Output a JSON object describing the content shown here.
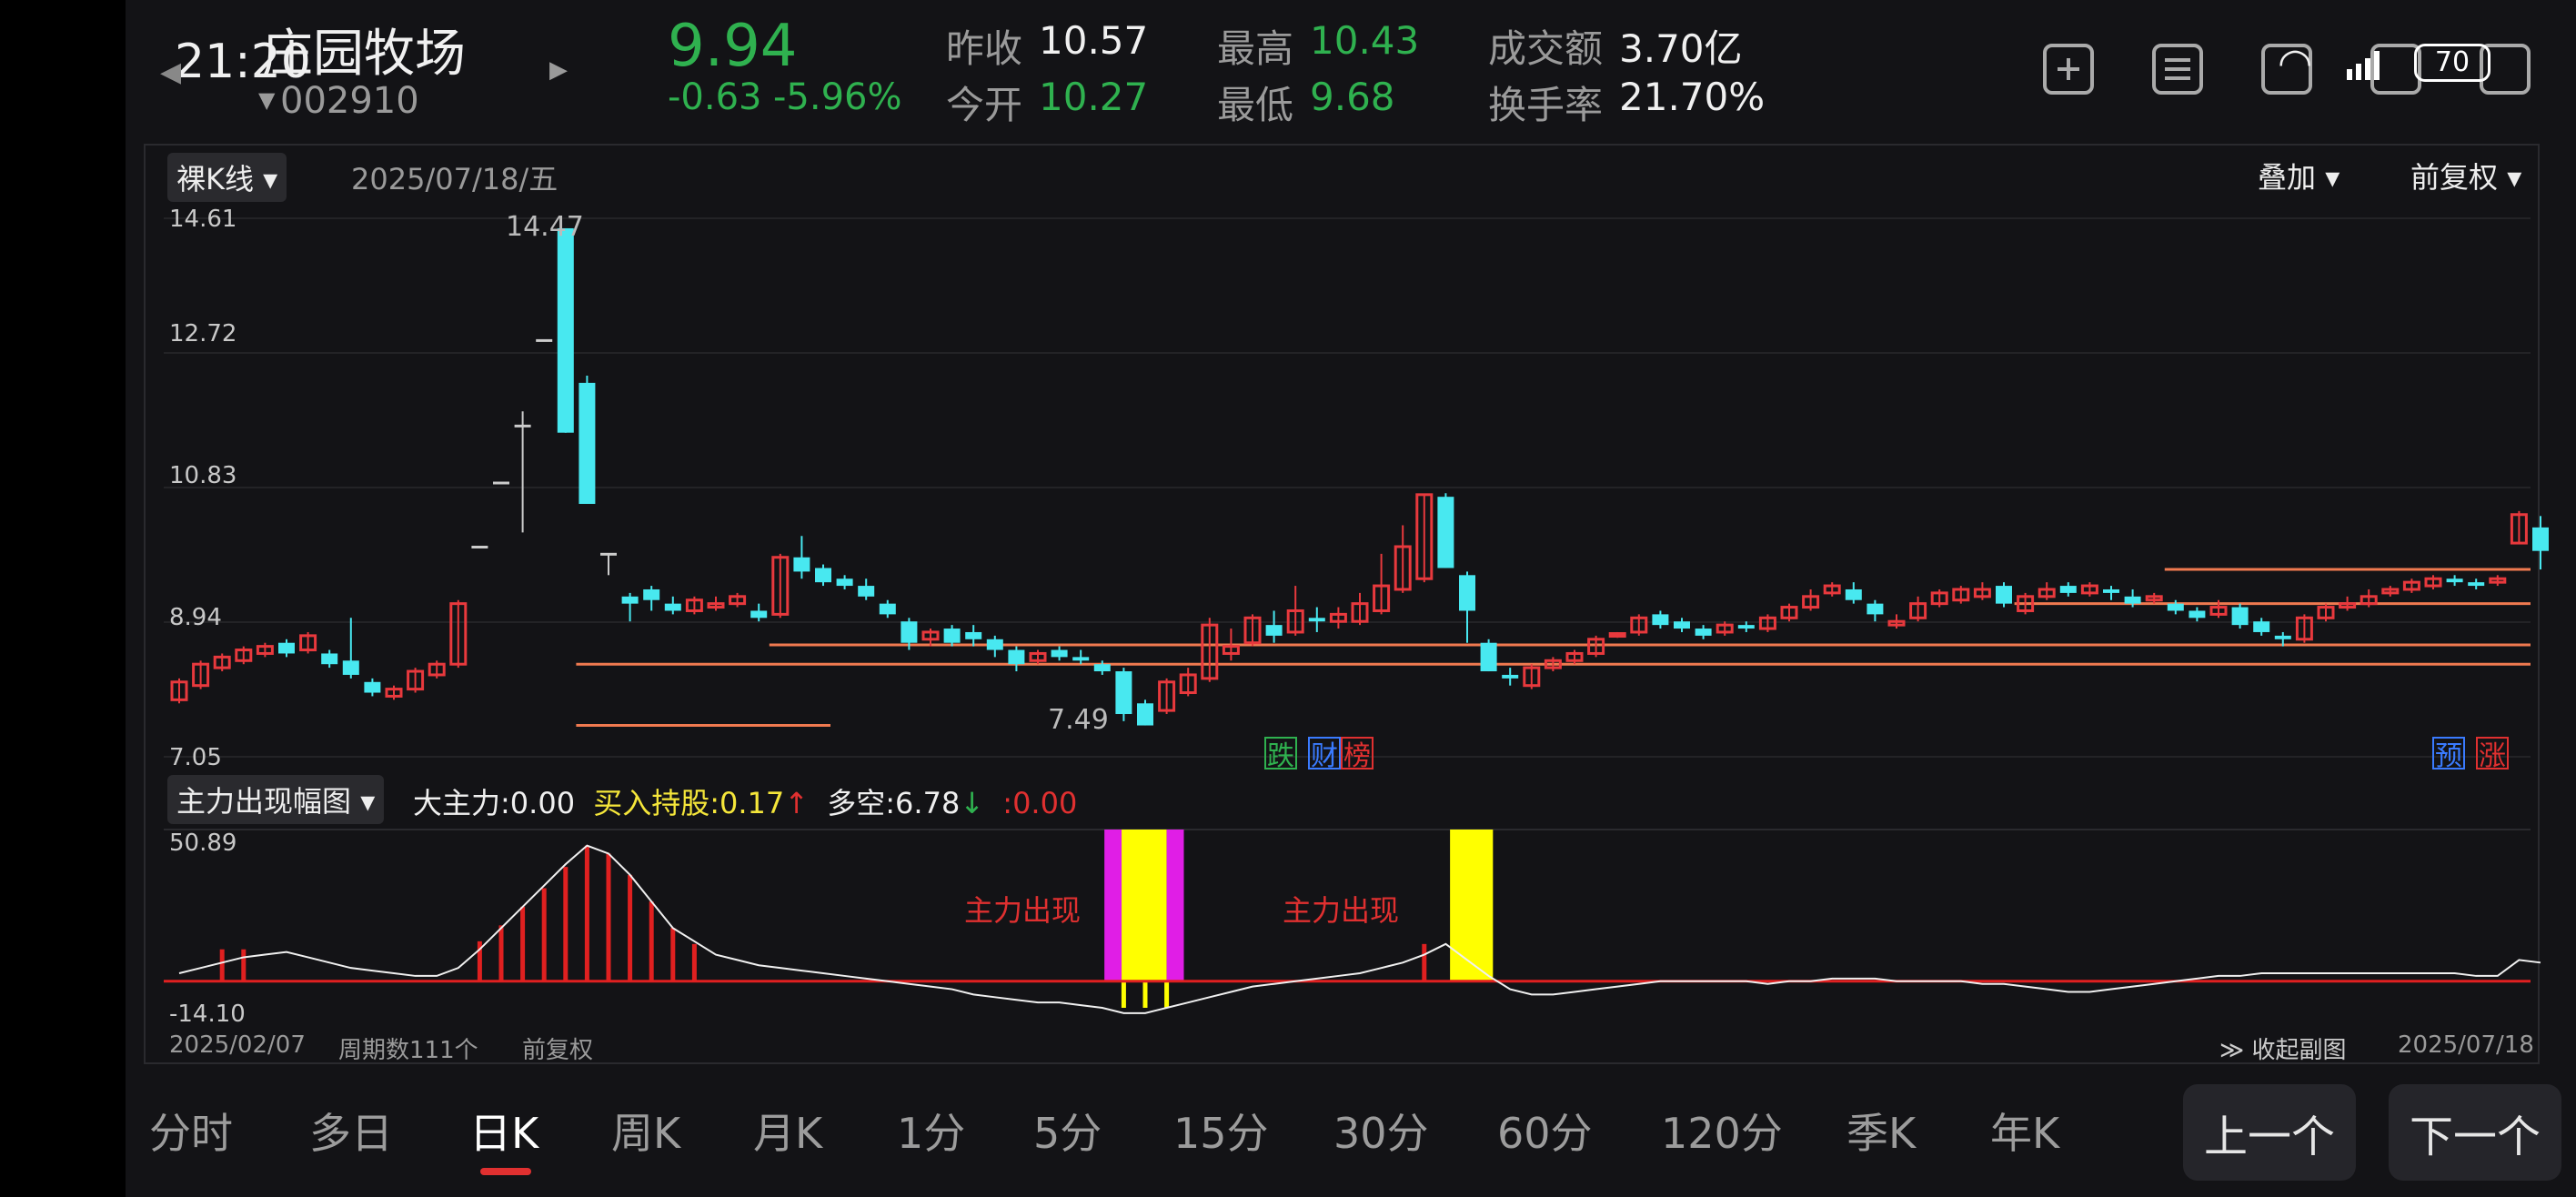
{
  "status": {
    "time": "21:20",
    "battery": "70"
  },
  "header": {
    "name": "庄园牧场",
    "code": "002910",
    "price": "9.94",
    "change": "-0.63",
    "change_pct": "-5.96%",
    "stats": [
      {
        "label": "昨收",
        "value": "10.57",
        "color": "#f0f0f0"
      },
      {
        "label": "今开",
        "value": "10.27",
        "color": "#2fb14f"
      },
      {
        "label": "最高",
        "value": "10.43",
        "color": "#2fb14f"
      },
      {
        "label": "最低",
        "value": "9.68",
        "color": "#2fb14f"
      },
      {
        "label": "成交额",
        "value": "3.70亿",
        "color": "#f0f0f0"
      },
      {
        "label": "换手率",
        "value": "21.70%",
        "color": "#f0f0f0"
      }
    ]
  },
  "chart_toolbar": {
    "mode": "裸K线",
    "date": "2025/07/18/五",
    "overlay": "叠加",
    "adjust": "前复权"
  },
  "chart_data": [
    {
      "type": "candlestick",
      "title": "日K",
      "ylim": [
        7.05,
        14.61
      ],
      "y_ticks": [
        "14.61",
        "12.72",
        "10.83",
        "8.94",
        "7.05"
      ],
      "annotations": {
        "high": "14.47",
        "low": "7.49"
      },
      "tags": [
        "跌",
        "财",
        "榜",
        "预",
        "涨"
      ],
      "candles": [
        [
          7.85,
          8.1,
          7.8,
          8.15
        ],
        [
          8.05,
          8.35,
          8.0,
          8.4
        ],
        [
          8.3,
          8.45,
          8.25,
          8.5
        ],
        [
          8.4,
          8.55,
          8.35,
          8.6
        ],
        [
          8.5,
          8.6,
          8.45,
          8.65
        ],
        [
          8.65,
          8.5,
          8.45,
          8.7
        ],
        [
          8.55,
          8.75,
          8.5,
          8.8
        ],
        [
          8.5,
          8.35,
          8.3,
          8.55
        ],
        [
          8.4,
          8.2,
          8.15,
          9.0
        ],
        [
          8.1,
          7.95,
          7.9,
          8.15
        ],
        [
          7.9,
          8.0,
          7.85,
          8.05
        ],
        [
          8.0,
          8.25,
          7.95,
          8.3
        ],
        [
          8.2,
          8.35,
          8.15,
          8.4
        ],
        [
          8.35,
          9.2,
          8.3,
          9.25
        ],
        [
          10.0,
          10.0,
          10.0,
          10.0
        ],
        [
          10.9,
          10.9,
          10.9,
          10.9
        ],
        [
          11.7,
          11.7,
          10.2,
          11.9
        ],
        [
          12.9,
          12.9,
          12.9,
          12.9
        ],
        [
          14.47,
          11.6,
          11.6,
          14.47
        ],
        [
          12.3,
          10.6,
          10.6,
          12.4
        ],
        [
          9.9,
          9.9,
          9.6,
          9.9
        ],
        [
          9.3,
          9.2,
          8.95,
          9.35
        ],
        [
          9.4,
          9.25,
          9.1,
          9.45
        ],
        [
          9.2,
          9.1,
          9.05,
          9.3
        ],
        [
          9.1,
          9.25,
          9.05,
          9.3
        ],
        [
          9.15,
          9.2,
          9.1,
          9.3
        ],
        [
          9.2,
          9.3,
          9.15,
          9.35
        ],
        [
          9.1,
          9.0,
          8.95,
          9.2
        ],
        [
          9.05,
          9.85,
          9.0,
          9.9
        ],
        [
          9.85,
          9.65,
          9.55,
          10.15
        ],
        [
          9.7,
          9.5,
          9.45,
          9.75
        ],
        [
          9.55,
          9.45,
          9.4,
          9.6
        ],
        [
          9.45,
          9.3,
          9.25,
          9.55
        ],
        [
          9.2,
          9.05,
          9.0,
          9.25
        ],
        [
          8.95,
          8.65,
          8.55,
          9.0
        ],
        [
          8.7,
          8.8,
          8.6,
          8.85
        ],
        [
          8.85,
          8.65,
          8.6,
          8.9
        ],
        [
          8.8,
          8.7,
          8.6,
          8.9
        ],
        [
          8.7,
          8.55,
          8.45,
          8.75
        ],
        [
          8.55,
          8.35,
          8.25,
          8.6
        ],
        [
          8.4,
          8.5,
          8.35,
          8.55
        ],
        [
          8.55,
          8.45,
          8.4,
          8.6
        ],
        [
          8.45,
          8.4,
          8.35,
          8.55
        ],
        [
          8.35,
          8.25,
          8.2,
          8.4
        ],
        [
          8.25,
          7.65,
          7.55,
          8.3
        ],
        [
          7.8,
          7.49,
          7.49,
          7.85
        ],
        [
          7.7,
          8.1,
          7.65,
          8.15
        ],
        [
          7.95,
          8.2,
          7.9,
          8.3
        ],
        [
          8.15,
          8.9,
          8.1,
          9.0
        ],
        [
          8.5,
          8.6,
          8.4,
          8.85
        ],
        [
          8.65,
          9.0,
          8.6,
          9.05
        ],
        [
          8.9,
          8.75,
          8.65,
          9.1
        ],
        [
          8.8,
          9.1,
          8.75,
          9.45
        ],
        [
          9.0,
          8.95,
          8.8,
          9.15
        ],
        [
          8.95,
          9.05,
          8.85,
          9.15
        ],
        [
          8.95,
          9.2,
          8.9,
          9.35
        ],
        [
          9.1,
          9.45,
          9.05,
          9.9
        ],
        [
          9.4,
          10.0,
          9.35,
          10.3
        ],
        [
          9.55,
          10.73,
          9.5,
          10.73
        ],
        [
          10.7,
          9.7,
          9.7,
          10.75
        ],
        [
          9.6,
          9.1,
          8.65,
          9.65
        ],
        [
          8.65,
          8.25,
          8.25,
          8.7
        ],
        [
          8.2,
          8.15,
          8.05,
          8.3
        ],
        [
          8.05,
          8.3,
          8.0,
          8.35
        ],
        [
          8.3,
          8.4,
          8.25,
          8.45
        ],
        [
          8.4,
          8.5,
          8.35,
          8.55
        ],
        [
          8.5,
          8.7,
          8.45,
          8.75
        ],
        [
          8.75,
          8.78,
          8.72,
          8.8
        ],
        [
          8.8,
          9.0,
          8.75,
          9.05
        ],
        [
          9.05,
          8.9,
          8.85,
          9.1
        ],
        [
          8.95,
          8.85,
          8.8,
          9.0
        ],
        [
          8.85,
          8.75,
          8.7,
          8.9
        ],
        [
          8.8,
          8.9,
          8.75,
          8.95
        ],
        [
          8.9,
          8.85,
          8.8,
          8.95
        ],
        [
          8.85,
          9.0,
          8.8,
          9.05
        ],
        [
          9.0,
          9.15,
          8.95,
          9.2
        ],
        [
          9.15,
          9.3,
          9.1,
          9.4
        ],
        [
          9.35,
          9.45,
          9.3,
          9.5
        ],
        [
          9.4,
          9.25,
          9.2,
          9.5
        ],
        [
          9.2,
          9.05,
          8.95,
          9.25
        ],
        [
          8.9,
          8.95,
          8.85,
          9.05
        ],
        [
          9.0,
          9.2,
          8.95,
          9.3
        ],
        [
          9.2,
          9.35,
          9.15,
          9.4
        ],
        [
          9.25,
          9.4,
          9.2,
          9.45
        ],
        [
          9.3,
          9.4,
          9.25,
          9.5
        ],
        [
          9.45,
          9.2,
          9.15,
          9.5
        ],
        [
          9.1,
          9.3,
          9.05,
          9.35
        ],
        [
          9.3,
          9.4,
          9.25,
          9.5
        ],
        [
          9.45,
          9.35,
          9.3,
          9.5
        ],
        [
          9.35,
          9.45,
          9.3,
          9.5
        ],
        [
          9.4,
          9.35,
          9.25,
          9.45
        ],
        [
          9.3,
          9.2,
          9.15,
          9.4
        ],
        [
          9.25,
          9.3,
          9.2,
          9.35
        ],
        [
          9.2,
          9.1,
          9.05,
          9.25
        ],
        [
          9.1,
          9.0,
          8.95,
          9.15
        ],
        [
          9.05,
          9.15,
          9.0,
          9.25
        ],
        [
          9.15,
          8.9,
          8.85,
          9.2
        ],
        [
          8.95,
          8.8,
          8.75,
          9.0
        ],
        [
          8.75,
          8.7,
          8.6,
          8.8
        ],
        [
          8.7,
          9.0,
          8.65,
          9.05
        ],
        [
          9.0,
          9.15,
          8.95,
          9.2
        ],
        [
          9.15,
          9.2,
          9.1,
          9.3
        ],
        [
          9.2,
          9.3,
          9.15,
          9.4
        ],
        [
          9.35,
          9.4,
          9.3,
          9.45
        ],
        [
          9.4,
          9.5,
          9.35,
          9.55
        ],
        [
          9.45,
          9.55,
          9.4,
          9.6
        ],
        [
          9.55,
          9.5,
          9.45,
          9.6
        ],
        [
          9.5,
          9.45,
          9.4,
          9.55
        ],
        [
          9.5,
          9.55,
          9.45,
          9.6
        ],
        [
          10.05,
          10.45,
          10.05,
          10.5
        ],
        [
          10.27,
          9.94,
          9.68,
          10.43
        ]
      ],
      "support_lines": [
        {
          "y": 7.49,
          "from": 19,
          "to": 30
        },
        {
          "y": 8.35,
          "from": 19,
          "to": 111
        },
        {
          "y": 8.62,
          "from": 28,
          "to": 111
        },
        {
          "y": 9.2,
          "from": 86,
          "to": 111
        },
        {
          "y": 9.68,
          "from": 93,
          "to": 111
        }
      ]
    },
    {
      "type": "bar",
      "title": "主力出现幅图",
      "ylim": [
        -14.1,
        50.89
      ],
      "y_ticks": [
        "50.89",
        "-14.10"
      ],
      "legend": [
        {
          "label": "大主力",
          "value": "0.00",
          "color": "#f0f0f0",
          "arrow": ""
        },
        {
          "label": "买入持股",
          "value": "0.17",
          "color": "#f5e63a",
          "arrow": "↑"
        },
        {
          "label": "多空",
          "value": "6.78",
          "color": "#f0f0f0",
          "arrow": "↓"
        },
        {
          "label": "",
          "value": "0.00",
          "color": "#e03030",
          "arrow": ""
        }
      ],
      "event_label": "主力出现",
      "line": [
        3,
        5,
        7,
        9,
        10,
        11,
        9,
        7,
        5,
        4,
        3,
        2,
        2,
        5,
        12,
        20,
        28,
        36,
        44,
        51,
        48,
        40,
        30,
        20,
        15,
        10,
        8,
        6,
        5,
        4,
        3,
        2,
        1,
        0,
        -1,
        -2,
        -3,
        -5,
        -6,
        -7,
        -8,
        -8,
        -9,
        -10,
        -12,
        -12,
        -10,
        -8,
        -6,
        -4,
        -2,
        -1,
        0,
        1,
        2,
        3,
        5,
        7,
        10,
        14,
        8,
        2,
        -3,
        -5,
        -5,
        -4,
        -3,
        -2,
        -1,
        0,
        0,
        0,
        0,
        0,
        -1,
        0,
        0,
        1,
        1,
        1,
        0,
        0,
        0,
        0,
        -1,
        -1,
        -2,
        -3,
        -4,
        -4,
        -3,
        -2,
        -1,
        0,
        1,
        2,
        2,
        3,
        3,
        3,
        3,
        3,
        3,
        3,
        3,
        3,
        3,
        2,
        2,
        8,
        7
      ],
      "red_bars": [
        {
          "i": 2,
          "v": 12
        },
        {
          "i": 3,
          "v": 12
        },
        {
          "i": 14,
          "v": 15
        },
        {
          "i": 15,
          "v": 21
        },
        {
          "i": 16,
          "v": 28
        },
        {
          "i": 17,
          "v": 35
        },
        {
          "i": 18,
          "v": 43
        },
        {
          "i": 19,
          "v": 51
        },
        {
          "i": 20,
          "v": 48
        },
        {
          "i": 21,
          "v": 40
        },
        {
          "i": 22,
          "v": 30
        },
        {
          "i": 23,
          "v": 20
        },
        {
          "i": 24,
          "v": 14
        },
        {
          "i": 58,
          "v": 14
        }
      ],
      "event_bands": [
        {
          "from": 43.1,
          "to": 43.9,
          "color": "#e01ee6"
        },
        {
          "from": 43.9,
          "to": 46.0,
          "color": "#ffff00"
        },
        {
          "from": 46.0,
          "to": 46.8,
          "color": "#e01ee6"
        },
        {
          "from": 59.2,
          "to": 61.2,
          "color": "#ffff00"
        }
      ],
      "yellow_neg": [
        44,
        45,
        46
      ]
    }
  ],
  "sub_footer": {
    "start": "2025/02/07",
    "period": "周期数111个",
    "adjust": "前复权",
    "collapse": "收起副图",
    "end": "2025/07/18"
  },
  "tabs": [
    "分时",
    "多日",
    "日K",
    "周K",
    "月K",
    "1分",
    "5分",
    "15分",
    "30分",
    "60分",
    "120分",
    "季K",
    "年K"
  ],
  "nav": {
    "prev": "上一个",
    "next": "下一个"
  }
}
